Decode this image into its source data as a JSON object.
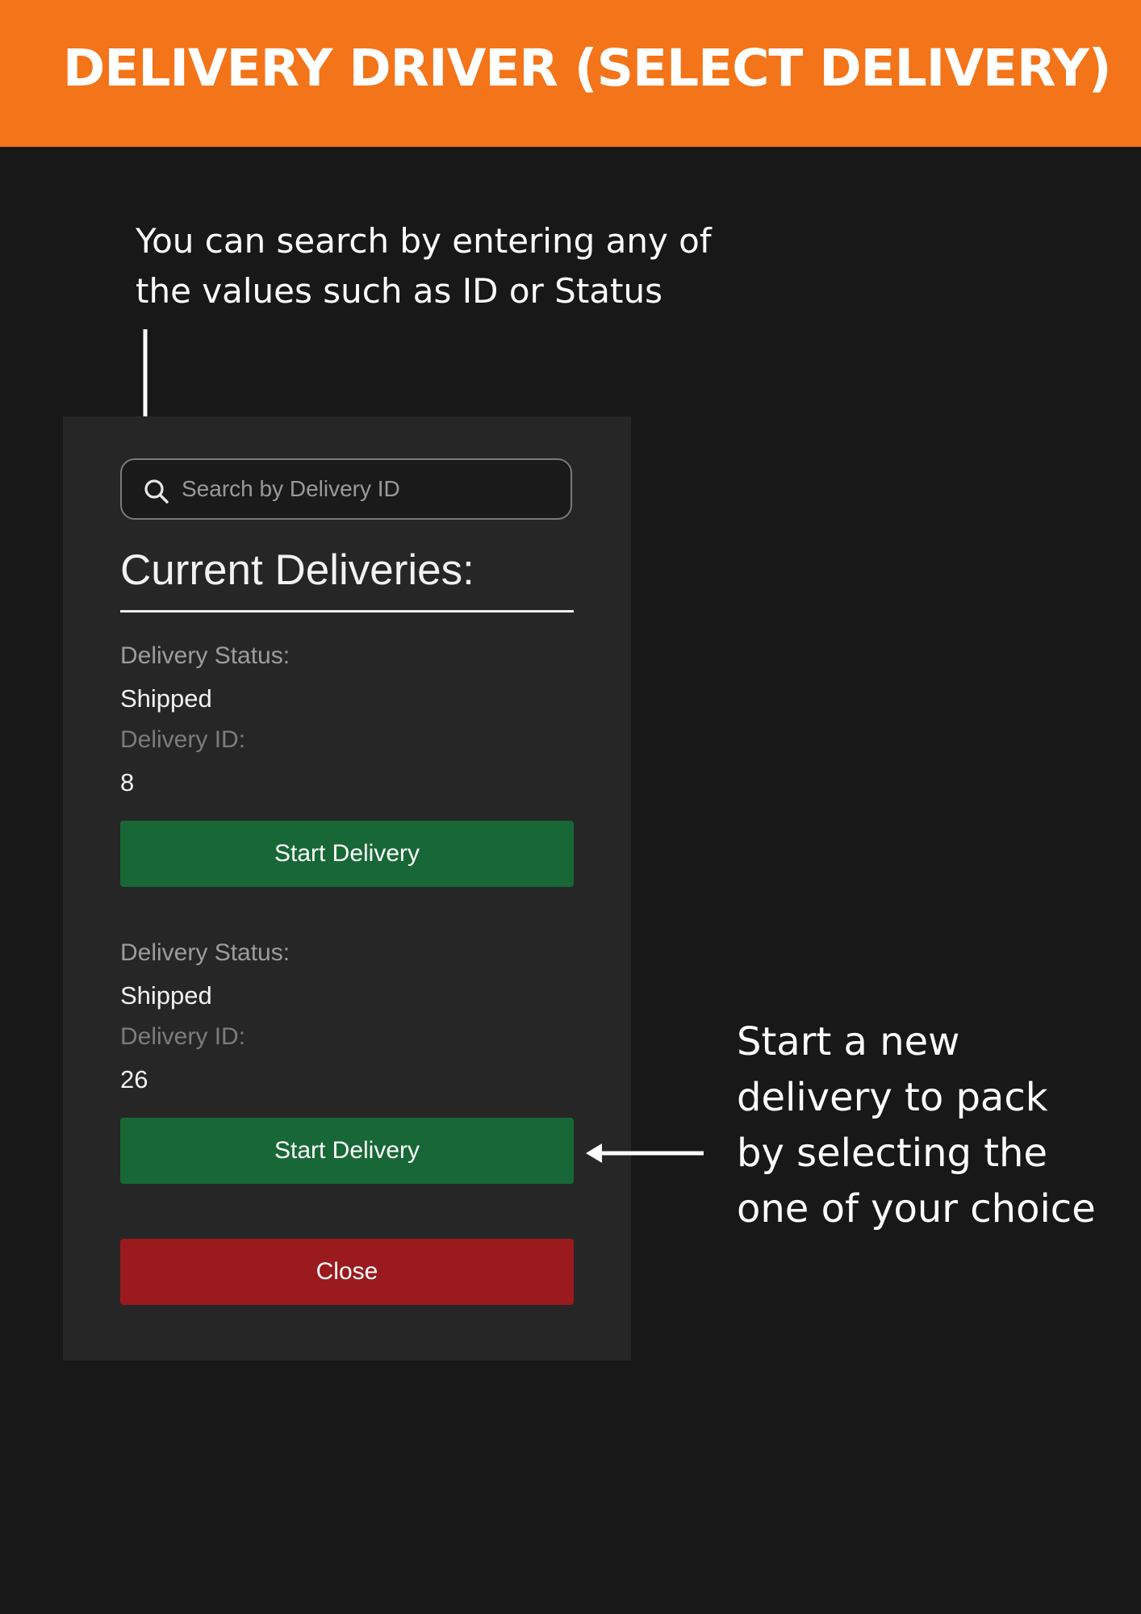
{
  "banner": {
    "title": "DELIVERY DRIVER (SELECT DELIVERY)",
    "color": "#f47419"
  },
  "annotations": {
    "search_note": "You can search by entering any of the values such as ID or Status",
    "start_note": "Start a new delivery to pack by selecting the one of your choice"
  },
  "search": {
    "placeholder": "Search by Delivery ID",
    "value": "",
    "icon": "search-icon"
  },
  "section": {
    "title": "Current Deliveries:"
  },
  "labels": {
    "status": "Delivery Status:",
    "id": "Delivery ID:",
    "start_button": "Start Delivery",
    "close_button": "Close"
  },
  "deliveries": [
    {
      "status": "Shipped",
      "id": "8"
    },
    {
      "status": "Shipped",
      "id": "26"
    }
  ],
  "colors": {
    "start_button": "#176836",
    "close_button": "#9a1a1d",
    "background": "#181818",
    "panel": "#262626"
  }
}
